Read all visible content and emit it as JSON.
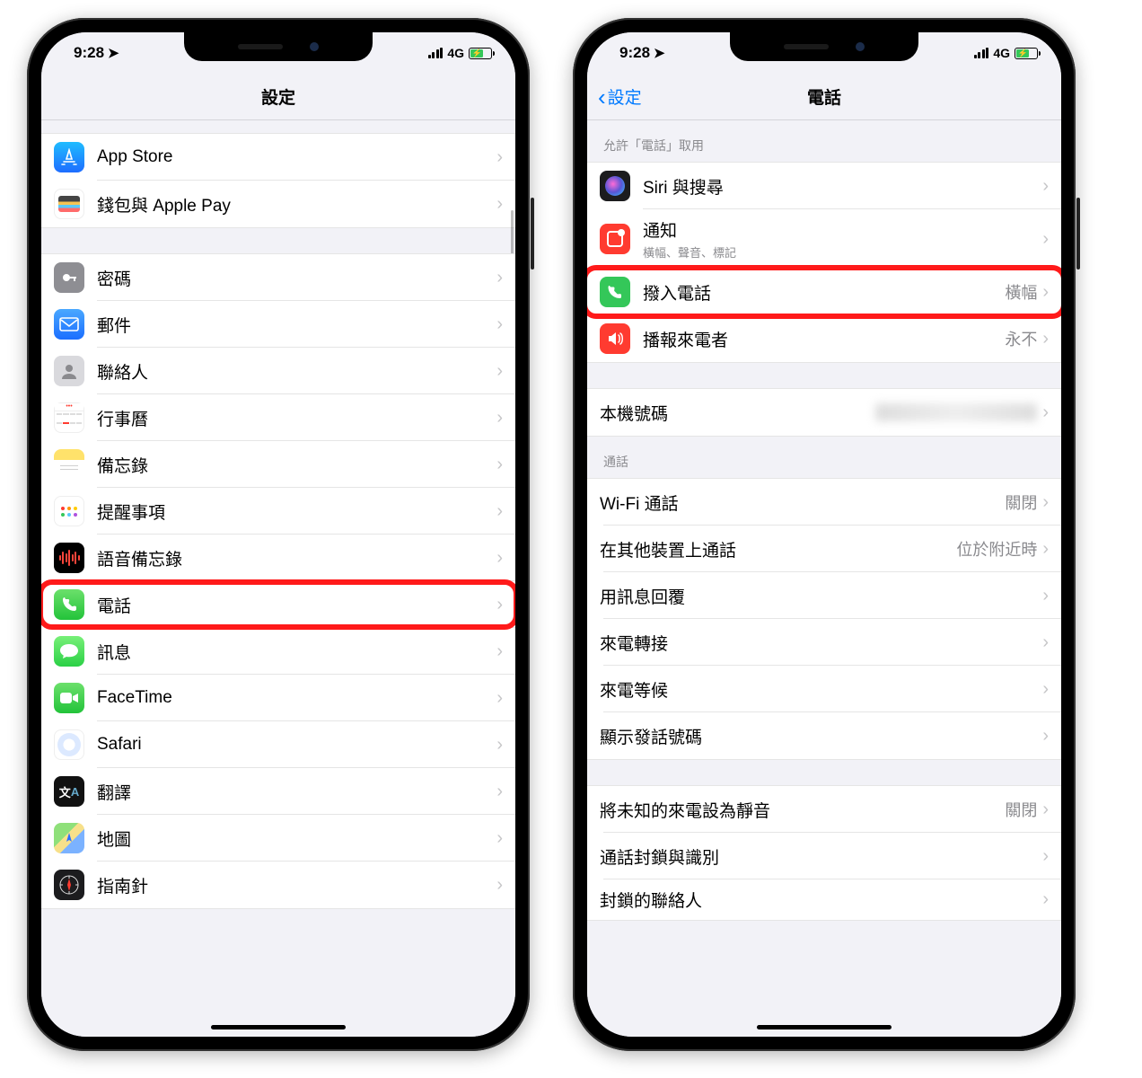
{
  "status": {
    "time": "9:28",
    "network": "4G"
  },
  "left": {
    "title": "設定",
    "groups": {
      "g1": [
        {
          "id": "appstore",
          "label": "App Store"
        },
        {
          "id": "wallet",
          "label": "錢包與 Apple Pay"
        }
      ],
      "g2": [
        {
          "id": "passwords",
          "label": "密碼"
        },
        {
          "id": "mail",
          "label": "郵件"
        },
        {
          "id": "contacts",
          "label": "聯絡人"
        },
        {
          "id": "calendar",
          "label": "行事曆"
        },
        {
          "id": "notes",
          "label": "備忘錄"
        },
        {
          "id": "reminders",
          "label": "提醒事項"
        },
        {
          "id": "voicememos",
          "label": "語音備忘錄"
        },
        {
          "id": "phone",
          "label": "電話",
          "highlight": true
        },
        {
          "id": "messages",
          "label": "訊息"
        },
        {
          "id": "facetime",
          "label": "FaceTime"
        },
        {
          "id": "safari",
          "label": "Safari"
        },
        {
          "id": "translate",
          "label": "翻譯"
        },
        {
          "id": "maps",
          "label": "地圖"
        },
        {
          "id": "compass",
          "label": "指南針"
        }
      ]
    }
  },
  "right": {
    "back": "設定",
    "title": "電話",
    "allow_header": "允許「電話」取用",
    "allow": {
      "siri": {
        "label": "Siri 與搜尋"
      },
      "notifications": {
        "label": "通知",
        "sub": "橫幅、聲音、標記"
      },
      "incoming": {
        "label": "撥入電話",
        "detail": "橫幅",
        "highlight": true
      },
      "announce": {
        "label": "播報來電者",
        "detail": "永不"
      }
    },
    "my_number": {
      "label": "本機號碼"
    },
    "calls_header": "通話",
    "calls": [
      {
        "id": "wifi",
        "label": "Wi-Fi 通話",
        "detail": "關閉"
      },
      {
        "id": "other",
        "label": "在其他裝置上通話",
        "detail": "位於附近時"
      },
      {
        "id": "respond",
        "label": "用訊息回覆"
      },
      {
        "id": "forward",
        "label": "來電轉接"
      },
      {
        "id": "waiting",
        "label": "來電等候"
      },
      {
        "id": "callerid",
        "label": "顯示發話號碼"
      }
    ],
    "silence": {
      "label": "將未知的來電設為靜音",
      "detail": "關閉"
    },
    "blocking": {
      "label": "通話封鎖與識別"
    },
    "blocked": {
      "label": "封鎖的聯絡人"
    }
  }
}
